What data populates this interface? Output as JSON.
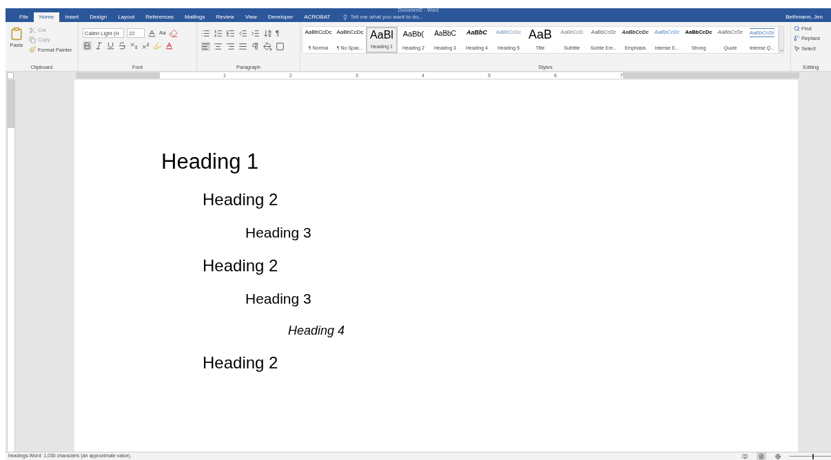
{
  "window": {
    "title": "Document2 - Word",
    "user": "Bethmann, Jen"
  },
  "tabs": [
    {
      "label": "File",
      "selected": false
    },
    {
      "label": "Home",
      "selected": true
    },
    {
      "label": "Insert",
      "selected": false
    },
    {
      "label": "Design",
      "selected": false
    },
    {
      "label": "Layout",
      "selected": false
    },
    {
      "label": "References",
      "selected": false
    },
    {
      "label": "Mailings",
      "selected": false
    },
    {
      "label": "Review",
      "selected": false
    },
    {
      "label": "View",
      "selected": false
    },
    {
      "label": "Developer",
      "selected": false
    },
    {
      "label": "ACROBAT",
      "selected": false
    }
  ],
  "tell_me": {
    "placeholder": "Tell me what you want to do..."
  },
  "clipboard": {
    "paste": "Paste",
    "cut": "Cut",
    "copy": "Copy",
    "format_painter": "Format Painter",
    "group": "Clipboard"
  },
  "font": {
    "name": "Calibri Light (H",
    "size": "22",
    "change_case": "Aa",
    "group": "Font"
  },
  "paragraph": {
    "group": "Paragraph",
    "show_marks": "¶"
  },
  "styles": {
    "group": "Styles",
    "items": [
      {
        "kind": "normal",
        "preview": "AaBbCcDc",
        "label": "¶ Normal",
        "selected": false
      },
      {
        "kind": "normal",
        "preview": "AaBbCcDc",
        "label": "¶ No Spac...",
        "selected": false
      },
      {
        "kind": "h1",
        "preview": "AaBl",
        "label": "Heading 1",
        "selected": true
      },
      {
        "kind": "h2",
        "preview": "AaBb(",
        "label": "Heading 2",
        "selected": false
      },
      {
        "kind": "h3",
        "preview": "AaBbC",
        "label": "Heading 3",
        "selected": false
      },
      {
        "kind": "h4",
        "preview": "AaBbC",
        "label": "Heading 4",
        "selected": false
      },
      {
        "kind": "h5",
        "preview": "AaBbCcDc",
        "label": "Heading 5",
        "selected": false
      },
      {
        "kind": "title",
        "preview": "AaB",
        "label": "Title",
        "selected": false
      },
      {
        "kind": "subtitle",
        "preview": "AaBbCcD",
        "label": "Subtitle",
        "selected": false
      },
      {
        "kind": "emph_light",
        "preview": "AaBbCcDc",
        "label": "Subtle Em...",
        "selected": false
      },
      {
        "kind": "emph",
        "preview": "AaBbCcDc",
        "label": "Emphasis",
        "selected": false
      },
      {
        "kind": "emph_blue",
        "preview": "AaBbCcDc",
        "label": "Intense E...",
        "selected": false
      },
      {
        "kind": "strong",
        "preview": "AaBbCcDc",
        "label": "Strong",
        "selected": false
      },
      {
        "kind": "emph_light",
        "preview": "AaBbCcDc",
        "label": "Quote",
        "selected": false
      },
      {
        "kind": "quote_blue",
        "preview": "AaBbCcDc",
        "label": "Intense Q...",
        "selected": false
      }
    ]
  },
  "editing": {
    "group": "Editing",
    "find": "Find",
    "replace": "Replace",
    "select": "Select"
  },
  "ruler": [
    "1",
    "2",
    "3",
    "4",
    "5",
    "6",
    "7"
  ],
  "document": [
    {
      "kind": "h1",
      "text": "Heading 1"
    },
    {
      "kind": "h2",
      "text": "Heading 2"
    },
    {
      "kind": "h3",
      "text": "Heading 3"
    },
    {
      "kind": "h2",
      "text": "Heading 2"
    },
    {
      "kind": "h3",
      "text": "Heading 3"
    },
    {
      "kind": "h4",
      "text": "Heading 4"
    },
    {
      "kind": "h2",
      "text": "Heading 2"
    }
  ],
  "status_bar": {
    "text": "headings-Word: 1,030 characters (an approximate value).",
    "views": [
      {
        "kind": "read",
        "selected": false
      },
      {
        "kind": "print",
        "selected": true
      },
      {
        "kind": "web",
        "selected": false
      }
    ],
    "zoom": {
      "level": 0.55
    }
  }
}
